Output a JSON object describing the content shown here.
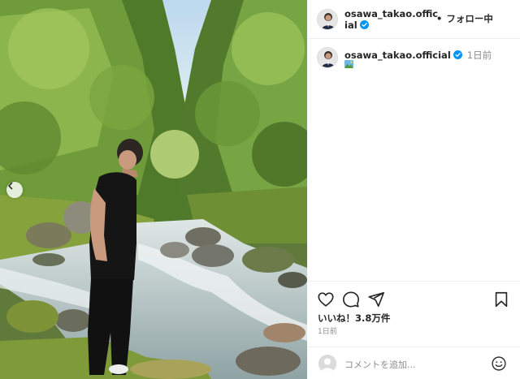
{
  "post": {
    "image_alt": "River gorge photo",
    "carousel": {
      "prev_icon": "chevron-left-icon"
    }
  },
  "header": {
    "username": "osawa_takao.official",
    "verified": true,
    "separator": "•",
    "follow_label": "フォロー中"
  },
  "caption": {
    "username": "osawa_takao.official",
    "time": "1日前",
    "emoji_icon": "landscape-emoji-icon"
  },
  "actions": {
    "icons": [
      "heart-icon",
      "comment-icon",
      "share-icon",
      "bookmark-icon"
    ],
    "likes_text": "いいね！3.8万件",
    "time_ago": "1日前"
  },
  "comment": {
    "placeholder": "コメントを追加...",
    "emoji_icon": "smiley-icon"
  },
  "colors": {
    "verified": "#0095f6",
    "muted": "#8e8e8e",
    "border": "#efefef"
  }
}
